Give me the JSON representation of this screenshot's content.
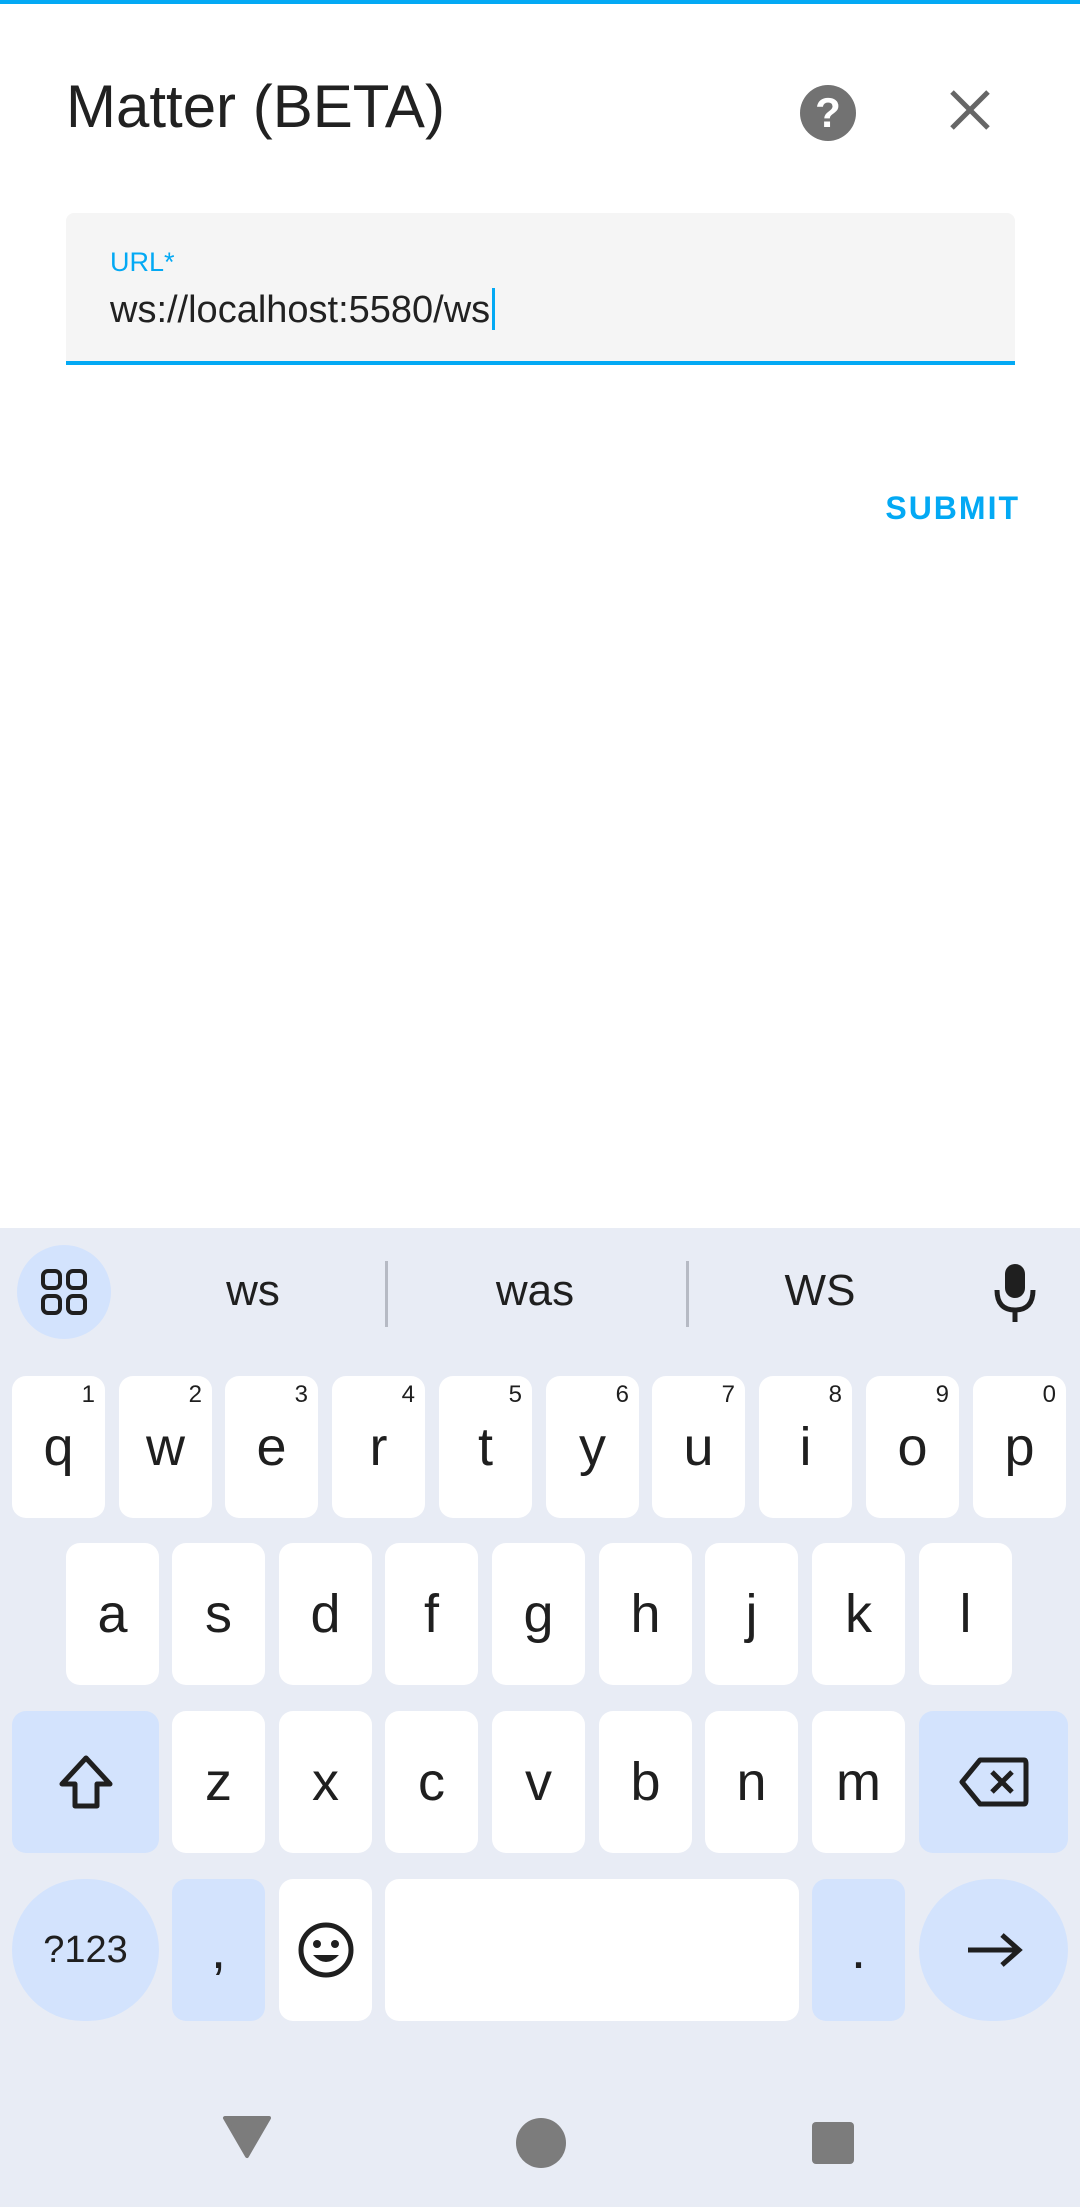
{
  "dialog": {
    "title": "Matter (BETA)",
    "help_icon": "help-circle-icon",
    "close_icon": "close-icon"
  },
  "form": {
    "url_label": "URL*",
    "url_value": "ws://localhost:5580/ws",
    "submit_label": "SUBMIT"
  },
  "colors": {
    "accent": "#03a9f4",
    "keyboard_bg": "#e8ecf5",
    "function_key_bg": "#d3e3fd"
  },
  "keyboard": {
    "suggestions": [
      "ws",
      "was",
      "WS"
    ],
    "row1": [
      {
        "key": "q",
        "num": "1"
      },
      {
        "key": "w",
        "num": "2"
      },
      {
        "key": "e",
        "num": "3"
      },
      {
        "key": "r",
        "num": "4"
      },
      {
        "key": "t",
        "num": "5"
      },
      {
        "key": "y",
        "num": "6"
      },
      {
        "key": "u",
        "num": "7"
      },
      {
        "key": "i",
        "num": "8"
      },
      {
        "key": "o",
        "num": "9"
      },
      {
        "key": "p",
        "num": "0"
      }
    ],
    "row2": [
      "a",
      "s",
      "d",
      "f",
      "g",
      "h",
      "j",
      "k",
      "l"
    ],
    "row3": [
      "z",
      "x",
      "c",
      "v",
      "b",
      "n",
      "m"
    ],
    "symbols_label": "?123",
    "comma": ",",
    "period": "."
  }
}
